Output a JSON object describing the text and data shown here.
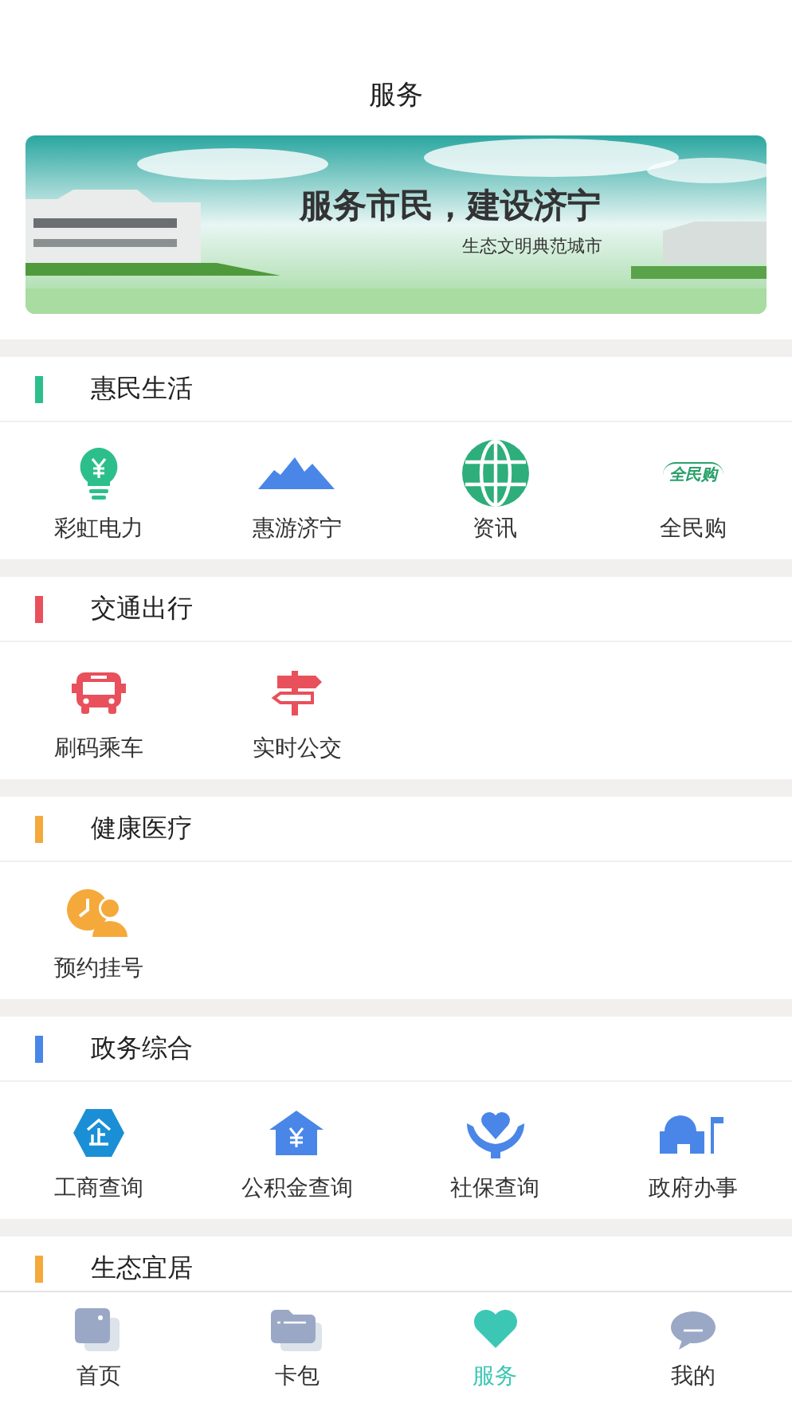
{
  "header": {
    "title": "服务"
  },
  "banner": {
    "headline": "服务市民，建设济宁",
    "tagline": "生态文明典范城市"
  },
  "sections": [
    {
      "title": "惠民生活",
      "color": "#2dbf8b",
      "items": [
        {
          "label": "彩虹电力",
          "kind": "bulb"
        },
        {
          "label": "惠游济宁",
          "kind": "mountains"
        },
        {
          "label": "资讯",
          "kind": "globe"
        },
        {
          "label": "全民购",
          "kind": "logo",
          "logo_text": "全民购"
        }
      ]
    },
    {
      "title": "交通出行",
      "color": "#e8505b",
      "items": [
        {
          "label": "刷码乘车",
          "kind": "bus"
        },
        {
          "label": "实时公交",
          "kind": "signpost"
        }
      ]
    },
    {
      "title": "健康医疗",
      "color": "#f5a93b",
      "items": [
        {
          "label": "预约挂号",
          "kind": "appointment"
        }
      ]
    },
    {
      "title": "政务综合",
      "color": "#4a86e8",
      "items": [
        {
          "label": "工商查询",
          "kind": "hexagon"
        },
        {
          "label": "公积金查询",
          "kind": "house"
        },
        {
          "label": "社保查询",
          "kind": "hands"
        },
        {
          "label": "政府办事",
          "kind": "building"
        }
      ]
    },
    {
      "title": "生态宜居",
      "color": "#f5a93b"
    }
  ],
  "tabbar": [
    {
      "label": "首页",
      "kind": "home",
      "selected": false
    },
    {
      "label": "卡包",
      "kind": "wallet",
      "selected": false
    },
    {
      "label": "服务",
      "kind": "service",
      "selected": true
    },
    {
      "label": "我的",
      "kind": "chat",
      "selected": false
    }
  ]
}
